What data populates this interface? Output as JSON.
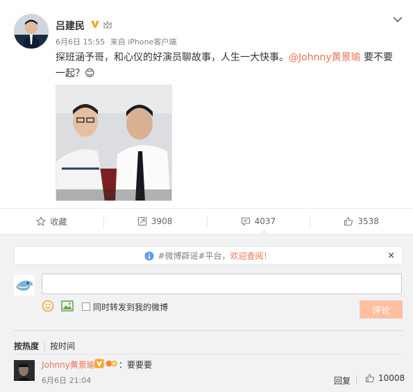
{
  "post": {
    "username": "吕建民",
    "date": "6月6日 15:55",
    "source": "来自 iPhone客户端",
    "text_before": "探班涵予哥，和心仪的好演员聊故事，人生一大快事。",
    "mention": "@Johnny黄景瑜",
    "text_after": " 要不要一起？😊"
  },
  "actions": {
    "favorite": "收藏",
    "repost_count": "3908",
    "comment_count": "4037",
    "like_count": "3538"
  },
  "notice": {
    "prefix": "#微博辟谣#平台，",
    "highlight": "欢迎查阅！",
    "close": "×"
  },
  "composer": {
    "placeholder": "",
    "repost_checkbox_label": "同时转发到我的微博",
    "submit_label": "评论"
  },
  "sort": {
    "hot": "按热度",
    "time": "按时间"
  },
  "comments": [
    {
      "name": "Johnny黄景瑜",
      "text": "：要要要",
      "time": "6月6日 21:04",
      "reply": "回复",
      "likes": "10008"
    }
  ],
  "colors": {
    "accent": "#eb7350",
    "submit_bg": "#ffc09f",
    "badge_orange": "#f5a623"
  },
  "icons": {
    "verified": "verified-v-icon",
    "crown": "crown-icon",
    "chevron": "chevron-down-icon",
    "star": "star-icon",
    "repost": "repost-icon",
    "comment": "comment-icon",
    "like": "thumbs-up-icon",
    "info": "info-icon",
    "emoji": "emoji-icon",
    "image": "image-icon"
  }
}
